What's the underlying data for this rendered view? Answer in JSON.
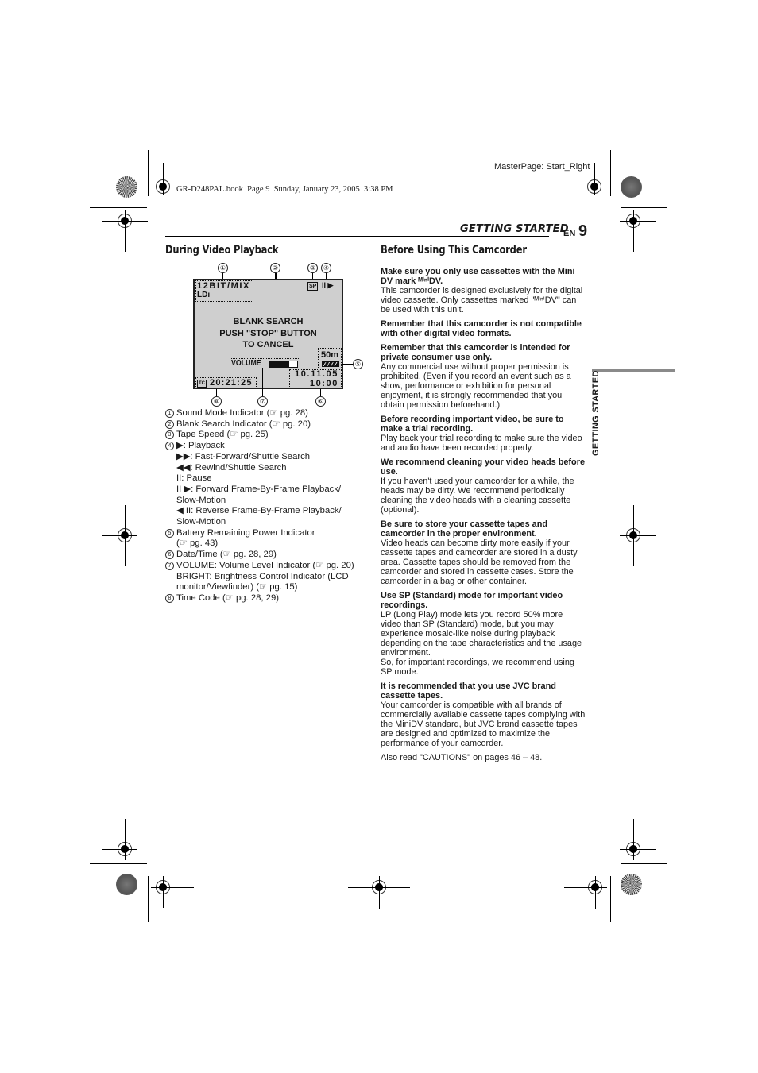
{
  "print_meta": {
    "masterpage": "MasterPage: Start_Right",
    "book_line": "GR-D248PAL.book  Page 9  Sunday, January 23, 2005  3:38 PM"
  },
  "header": {
    "running_title": "GETTING STARTED",
    "lang": "EN",
    "page_number": "9"
  },
  "side_tab": {
    "label": "GETTING STARTED"
  },
  "left": {
    "title": "During Video Playback",
    "diagram": {
      "callouts_top": [
        "①",
        "②",
        "③",
        "④"
      ],
      "callouts_bottom": [
        "⑧",
        "⑦",
        "⑥"
      ],
      "callout_right": "⑤",
      "sound_mode": "12BIT/MIX",
      "ld_icon": "LDı",
      "tape_speed": "SP",
      "playback_icons": "II ▶",
      "blank_search_lines": [
        "BLANK SEARCH",
        "PUSH \"STOP\" BUTTON",
        "TO CANCEL"
      ],
      "remaining": "50m",
      "volume_label": "VOLUME",
      "volume_level": 0.7,
      "date": "10.11.05",
      "time": "10:00",
      "tc_icon": "TC",
      "timecode": "20:21:25"
    },
    "legend": [
      {
        "num": "①",
        "text": "Sound Mode Indicator (☞ pg. 28)"
      },
      {
        "num": "②",
        "text": "Blank Search Indicator (☞ pg. 20)"
      },
      {
        "num": "③",
        "text": "Tape Speed (☞ pg. 25)"
      },
      {
        "num": "④",
        "text": "▶: Playback"
      },
      {
        "num": "",
        "text": "▶▶: Fast-Forward/Shuttle Search"
      },
      {
        "num": "",
        "text": "◀◀: Rewind/Shuttle Search"
      },
      {
        "num": "",
        "text": "II: Pause"
      },
      {
        "num": "",
        "text": "II ▶: Forward Frame-By-Frame Playback/"
      },
      {
        "num": "",
        "text": "Slow-Motion"
      },
      {
        "num": "",
        "text": "◀ II: Reverse Frame-By-Frame Playback/"
      },
      {
        "num": "",
        "text": "Slow-Motion"
      },
      {
        "num": "⑤",
        "text": "Battery Remaining Power Indicator"
      },
      {
        "num": "",
        "text": "(☞ pg. 43)"
      },
      {
        "num": "⑥",
        "text": "Date/Time (☞ pg. 28, 29)"
      },
      {
        "num": "⑦",
        "text": "VOLUME: Volume Level Indicator (☞ pg. 20)"
      },
      {
        "num": "",
        "text": "BRIGHT: Brightness Control Indicator (LCD"
      },
      {
        "num": "",
        "text": "monitor/Viewfinder) (☞ pg. 15)"
      },
      {
        "num": "⑧",
        "text": "Time Code (☞ pg. 28, 29)"
      }
    ]
  },
  "right": {
    "title": "Before Using This Camcorder",
    "paragraphs": [
      {
        "heading": "Make sure you only use cassettes with the Mini DV mark ᴹⁱⁿⁱDV.",
        "body": "This camcorder is designed exclusively for the digital video cassette. Only cassettes marked \"ᴹⁱⁿⁱDV\" can be used with this unit."
      },
      {
        "heading": "Remember that this camcorder is not compatible with other digital video formats.",
        "body": ""
      },
      {
        "heading": "Remember that this camcorder is intended for private consumer use only.",
        "body": "Any commercial use without proper permission is prohibited. (Even if you record an event such as a show, performance or exhibition for personal enjoyment, it is strongly recommended that you obtain permission beforehand.)"
      },
      {
        "heading": "Before recording important video, be sure to make a trial recording.",
        "body": "Play back your trial recording to make sure the video and audio have been recorded properly."
      },
      {
        "heading": "We recommend cleaning your video heads before use.",
        "body": "If you haven't used your camcorder for a while, the heads may be dirty. We recommend periodically cleaning the video heads with a cleaning cassette (optional)."
      },
      {
        "heading": "Be sure to store your cassette tapes and camcorder in the proper environment.",
        "body": "Video heads can become dirty more easily if your cassette tapes and camcorder are stored in a dusty area. Cassette tapes should be removed from the camcorder and stored in cassette cases. Store the camcorder in a bag or other container."
      },
      {
        "heading": "Use SP (Standard) mode for important video recordings.",
        "body": "LP (Long Play) mode lets you record 50% more video than SP (Standard) mode, but you may experience mosaic-like noise during playback depending on the tape characteristics and the usage environment.\nSo, for important recordings, we recommend using SP mode."
      },
      {
        "heading": "It is recommended that you use JVC brand cassette tapes.",
        "body": "Your camcorder is compatible with all brands of commercially available cassette tapes complying with the MiniDV standard, but JVC brand cassette tapes are designed and optimized to maximize the performance of your camcorder."
      },
      {
        "heading": "",
        "body": "Also read \"CAUTIONS\" on pages 46 – 48."
      }
    ]
  }
}
